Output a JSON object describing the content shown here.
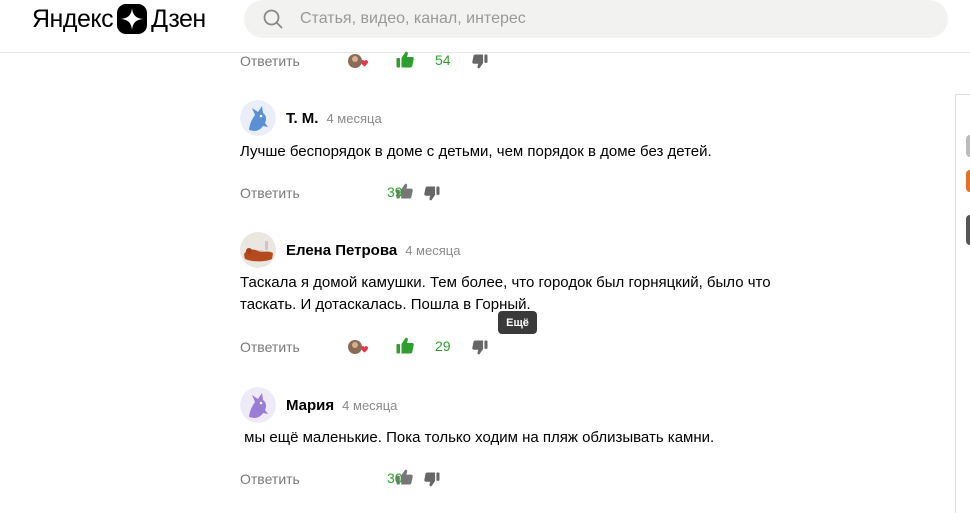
{
  "header": {
    "logo_left": "Яндекс",
    "logo_right": "Дзен",
    "search_placeholder": "Статья, видео, канал, интерес"
  },
  "reply_label": "Ответить",
  "tooltip": "Ещё",
  "top_row": {
    "likes": "54"
  },
  "comments": [
    {
      "author": "Т. М.",
      "time": "4 месяца",
      "text": "Лучше беспорядок в доме с детьми, чем порядок в доме без детей.",
      "likes": "39"
    },
    {
      "author": "Елена Петрова",
      "time": "4 месяца",
      "text": "Таскала я домой камушки. Тем более, что городок был горняцкий, было что таскать. И дотаскалась. Пошла в Горный.",
      "likes": "29"
    },
    {
      "author": "Мария",
      "time": "4 месяца",
      "text": " мы ещё маленькие. Пока только ходим на пляж облизывать камни.",
      "likes": "30"
    }
  ],
  "colors": {
    "like_active": "#2e9e2e",
    "icon_gray": "#7a7a7a",
    "avatar_blue": "#5b8fd6",
    "avatar_purple": "#9a7dd6"
  }
}
